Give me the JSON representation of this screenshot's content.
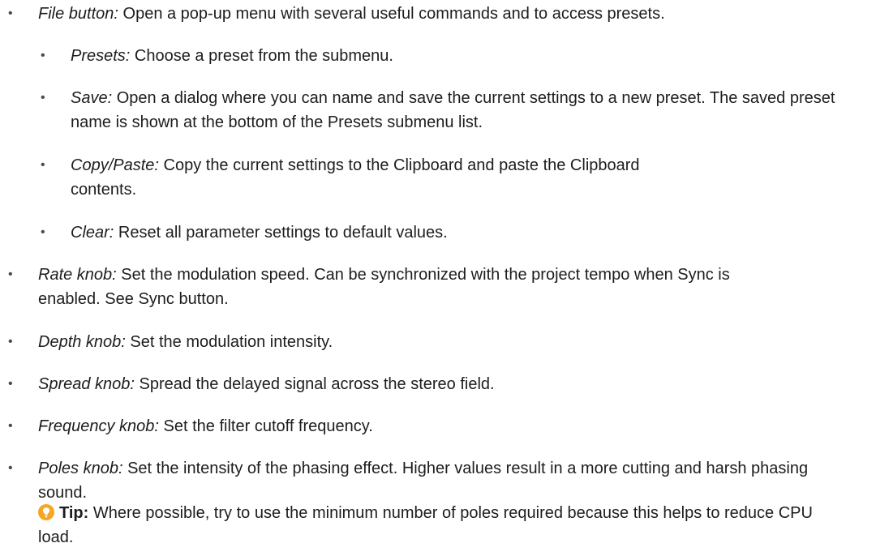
{
  "items": [
    {
      "level": 1,
      "term": "File button:",
      "text": " Open a pop-up menu with several useful commands and to access presets."
    },
    {
      "level": 2,
      "term": "Presets:",
      "text": " Choose a preset from the submenu."
    },
    {
      "level": 2,
      "term": "Save:",
      "text": " Open a dialog where you can name and save the current settings to a new preset. The saved preset name is shown at the bottom of the Presets submenu list."
    },
    {
      "level": 2,
      "term": "Copy/Paste:",
      "text": " Copy the current settings to the Clipboard and paste the Clipboard contents."
    },
    {
      "level": 2,
      "term": "Clear:",
      "text": " Reset all parameter settings to default values."
    },
    {
      "level": 1,
      "term": "Rate knob:",
      "text": " Set the modulation speed. Can be synchronized with the project tempo when Sync is enabled. See Sync button."
    },
    {
      "level": 1,
      "term": "Depth knob:",
      "text": " Set the modulation intensity."
    },
    {
      "level": 1,
      "term": "Spread knob:",
      "text": " Spread the delayed signal across the stereo field."
    },
    {
      "level": 1,
      "term": "Frequency knob:",
      "text": " Set the filter cutoff frequency."
    },
    {
      "level": 1,
      "term": "Poles knob:",
      "text": " Set the intensity of the phasing effect. Higher values result in a more cutting and harsh phasing sound."
    }
  ],
  "tip": {
    "label": "Tip:",
    "text": " Where possible, try to use the minimum number of poles required because this helps to reduce CPU load.",
    "icon": "lightbulb-icon",
    "icon_color": "#f5a623"
  }
}
